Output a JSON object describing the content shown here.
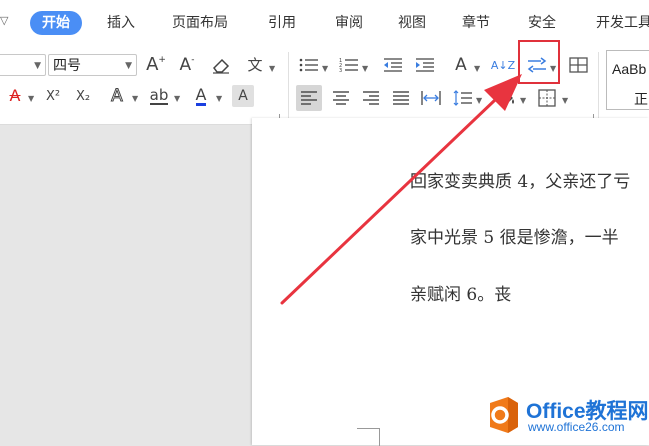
{
  "menu": {
    "tabs": [
      {
        "label": "开始",
        "active": true
      },
      {
        "label": "插入"
      },
      {
        "label": "页面布局"
      },
      {
        "label": "引用"
      },
      {
        "label": "审阅"
      },
      {
        "label": "视图"
      },
      {
        "label": "章节"
      },
      {
        "label": "安全"
      },
      {
        "label": "开发工具"
      }
    ],
    "active_color": "#4a8ef5"
  },
  "ribbon": {
    "font_size_value": "四号",
    "icons": {
      "grow_font": "A",
      "shrink_font": "A",
      "superscript": "X²",
      "subscript": "X₂",
      "text_effect": "A",
      "font_color": "A",
      "char_shading": "A",
      "pinyin": "文",
      "highlight": "ab",
      "sort": "A↓Z"
    },
    "style_preview": {
      "line1": "AaBb",
      "line2": "正"
    }
  },
  "document": {
    "lines": [
      "回家变卖典质 4，父亲还了亏",
      "家中光景 5 很是惨澹，一半",
      "亲赋闲 6。丧"
    ]
  },
  "watermark": {
    "title": "Office教程网",
    "url": "www.office26.com"
  },
  "colors": {
    "highlight_box": "#e0313b",
    "arrow": "#e8343f",
    "logo_blue": "#1f73d6",
    "logo_orange": "#f07a1a"
  }
}
